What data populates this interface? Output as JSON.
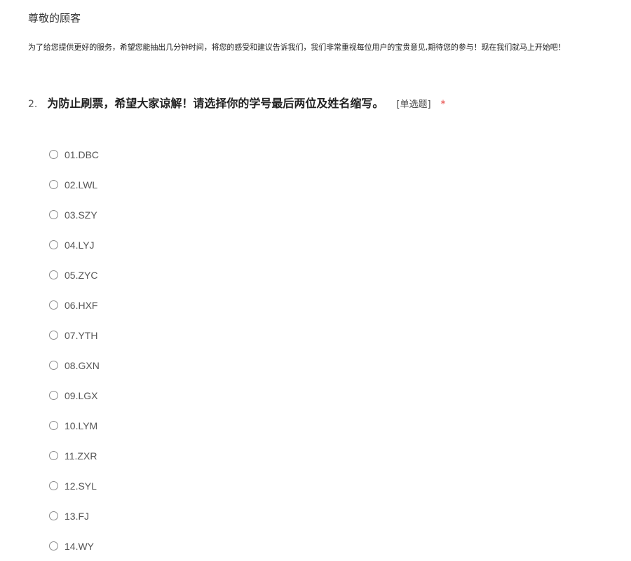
{
  "survey": {
    "greeting": "尊敬的顾客",
    "intro": "为了给您提供更好的服务，希望您能抽出几分钟时间，将您的感受和建议告诉我们，我们非常重视每位用户的宝贵意见,期待您的参与！现在我们就马上开始吧！"
  },
  "question": {
    "number": "2.",
    "title": "为防止刷票，希望大家谅解！请选择你的学号最后两位及姓名缩写。",
    "type_label": "[单选题]",
    "required_mark": "*",
    "selected": null,
    "options": [
      "01.DBC",
      "02.LWL",
      "03.SZY",
      "04.LYJ",
      "05.ZYC",
      "06.HXF",
      "07.YTH",
      "08.GXN",
      "09.LGX",
      "10.LYM",
      "11.ZXR",
      "12.SYL",
      "13.FJ",
      "14.WY"
    ]
  },
  "colors": {
    "required": "#e64340",
    "text": "#333333",
    "radio_border": "#8a8a8a"
  }
}
